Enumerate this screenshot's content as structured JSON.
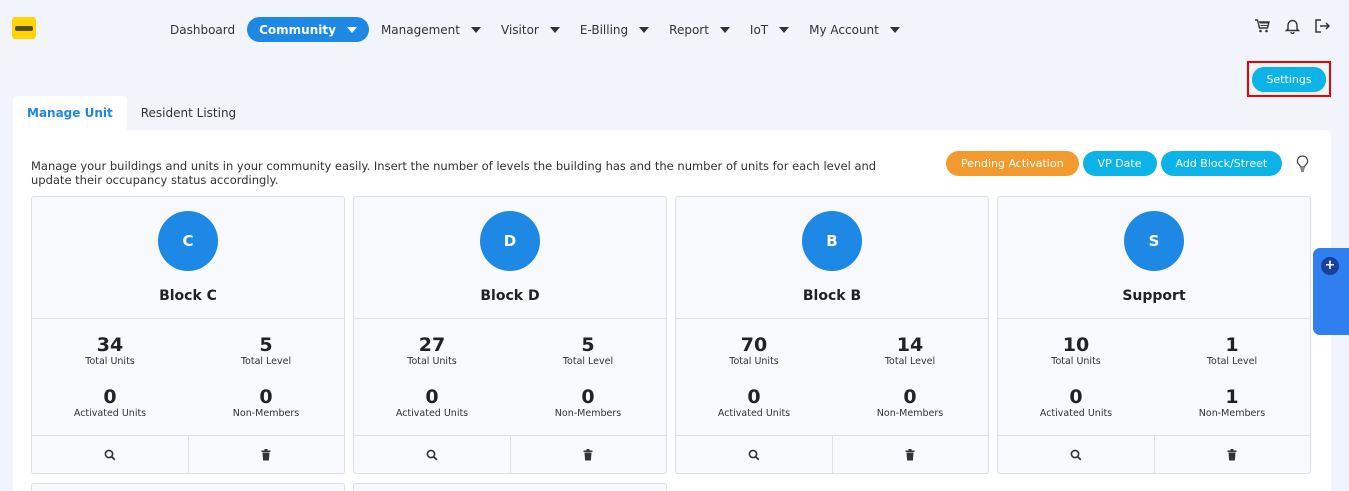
{
  "nav": {
    "items": [
      {
        "label": "Dashboard",
        "has_caret": false,
        "active": false
      },
      {
        "label": "Community",
        "has_caret": true,
        "active": true
      },
      {
        "label": "Management",
        "has_caret": true,
        "active": false
      },
      {
        "label": "Visitor",
        "has_caret": true,
        "active": false
      },
      {
        "label": "E-Billing",
        "has_caret": true,
        "active": false
      },
      {
        "label": "Report",
        "has_caret": true,
        "active": false
      },
      {
        "label": "IoT",
        "has_caret": true,
        "active": false
      },
      {
        "label": "My Account",
        "has_caret": true,
        "active": false
      }
    ],
    "icons": [
      "cart-icon",
      "bell-icon",
      "logout-icon"
    ]
  },
  "settings_label": "Settings",
  "tabs": [
    {
      "label": "Manage Unit",
      "active": true
    },
    {
      "label": "Resident Listing",
      "active": false
    }
  ],
  "description": "Manage your buildings and units in your community easily. Insert the number of levels the building has and the number of units for each level and update their occupancy status accordingly.",
  "actions": {
    "pending": "Pending Activation",
    "vp_date": "VP Date",
    "add_block": "Add Block/Street"
  },
  "labels": {
    "total_units": "Total Units",
    "total_level": "Total Level",
    "activated_units": "Activated Units",
    "non_members": "Non-Members"
  },
  "blocks": [
    {
      "initial": "C",
      "name": "Block C",
      "total_units": "34",
      "total_level": "5",
      "activated_units": "0",
      "non_members": "0"
    },
    {
      "initial": "D",
      "name": "Block D",
      "total_units": "27",
      "total_level": "5",
      "activated_units": "0",
      "non_members": "0"
    },
    {
      "initial": "B",
      "name": "Block B",
      "total_units": "70",
      "total_level": "14",
      "activated_units": "0",
      "non_members": "0"
    },
    {
      "initial": "S",
      "name": "Support",
      "total_units": "10",
      "total_level": "1",
      "activated_units": "0",
      "non_members": "1"
    }
  ],
  "colors": {
    "primary": "#1e88e5",
    "cyan": "#0bb3e8",
    "orange": "#f29a2e",
    "background": "#f1f4fa",
    "highlight": "#e00000"
  }
}
